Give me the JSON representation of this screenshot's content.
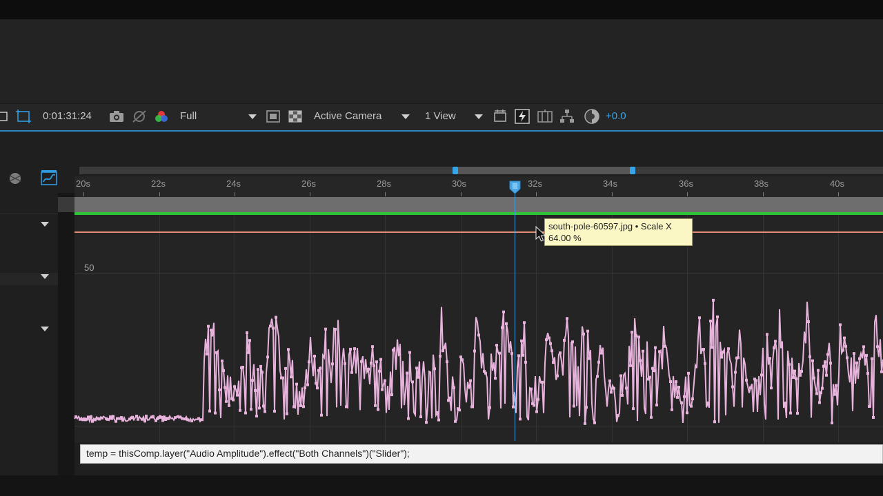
{
  "toolbar": {
    "timecode": "0:01:31:24",
    "resolution": "Full",
    "camera": "Active Camera",
    "views": "1 View",
    "exposure": "+0.0"
  },
  "ruler": {
    "ticks": [
      "20s",
      "22s",
      "24s",
      "26s",
      "28s",
      "30s",
      "32s",
      "34s",
      "36s",
      "38s",
      "40s"
    ]
  },
  "graph": {
    "value_label": "50"
  },
  "tooltip": {
    "line1": "south-pole-60597.jpg • Scale X",
    "line2": "64.00 %"
  },
  "expression": {
    "text": "temp = thisComp.layer(\"Audio Amplitude\").effect(\"Both Channels\")(\"Slider\");"
  },
  "colors": {
    "accent": "#2a87c4",
    "playhead": "#4a9fd6",
    "green_bar": "#2ec43a",
    "scale_curve": "#e58f72",
    "audio_curve": "#e7b3dc",
    "tooltip_bg": "#fbf7c4"
  }
}
